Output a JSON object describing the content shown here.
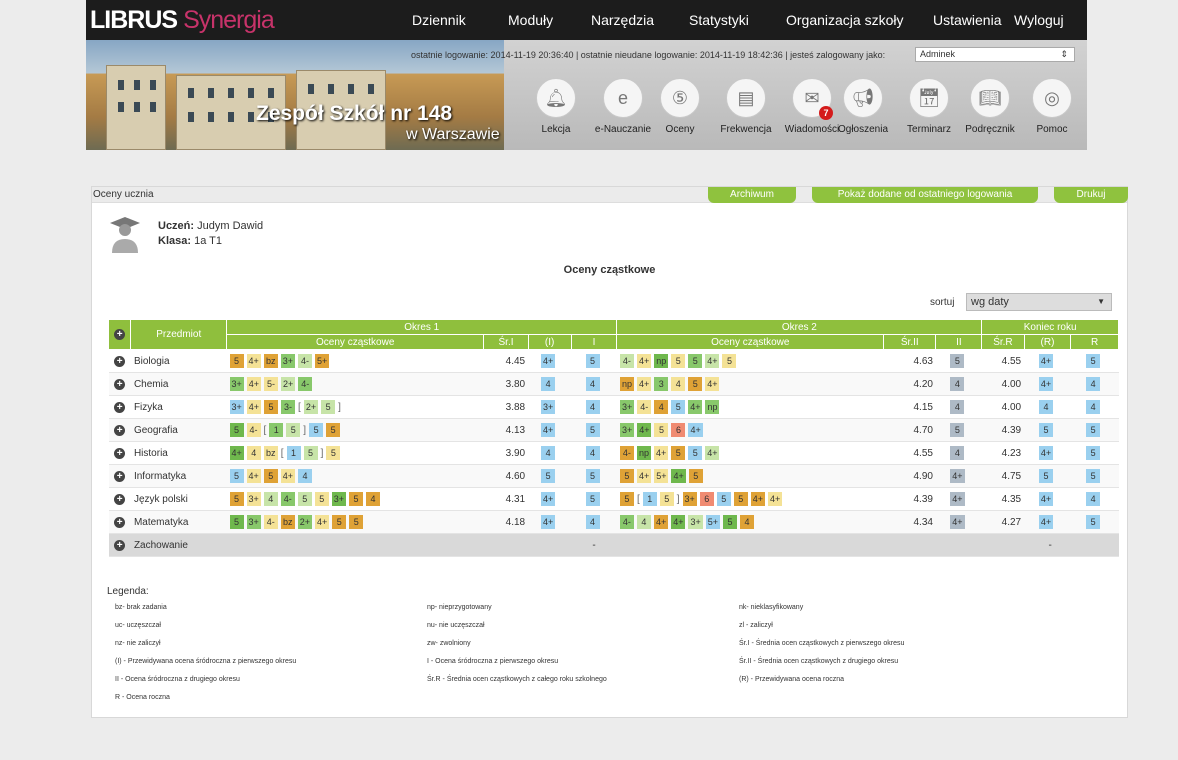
{
  "header": {
    "logo_main": "LIBRUS",
    "logo_sub": "Synergia",
    "nav": [
      "Dziennik",
      "Moduły",
      "Narzędzia",
      "Statystyki",
      "Organizacja szkoły",
      "Ustawienia",
      "Wyloguj"
    ],
    "login_info": "ostatnie logowanie: 2014-11-19 20:36:40  |  ostatnie nieudane logowanie: 2014-11-19 18:42:36  |  jesteś zalogowany jako:",
    "user": "Adminek",
    "school_name": "Zespół Szkół nr 148",
    "school_city": "w Warszawie",
    "modules": [
      {
        "label": "Lekcja",
        "icon": "bell-icon"
      },
      {
        "label": "e-Nauczanie",
        "icon": "e-icon"
      },
      {
        "label": "Oceny",
        "icon": "grade-icon"
      },
      {
        "label": "Frekwencja",
        "icon": "attendance-icon"
      },
      {
        "label": "Wiadomości",
        "icon": "envelope-icon",
        "badge": "7"
      },
      {
        "label": "Ogłoszenia",
        "icon": "megaphone-icon"
      },
      {
        "label": "Terminarz",
        "icon": "calendar-icon"
      },
      {
        "label": "Podręcznik",
        "icon": "book-icon"
      },
      {
        "label": "Pomoc",
        "icon": "lifebuoy-icon"
      }
    ]
  },
  "panel": {
    "title": "Oceny ucznia",
    "buttons": [
      "Archiwum",
      "Pokaż dodane od ostatniego logowania",
      "Drukuj"
    ],
    "student_label": "Uczeń:",
    "student_name": "Judym Dawid",
    "class_label": "Klasa:",
    "class_name": "1a T1",
    "section_title": "Oceny cząstkowe",
    "sort_label": "sortuj",
    "sort_value": "wg daty"
  },
  "table": {
    "headers": {
      "subject": "Przedmiot",
      "period1": "Okres 1",
      "period2": "Okres 2",
      "year_end": "Koniec roku",
      "partial": "Oceny cząstkowe",
      "avg1": "Śr.I",
      "pred1": "(I)",
      "final1": "I",
      "avg2": "Śr.II",
      "final2": "II",
      "avgR": "Śr.R",
      "predR": "(R)",
      "finalR": "R"
    },
    "rows": [
      {
        "subject": "Biologia",
        "p1": [
          [
            "5",
            "o"
          ],
          [
            "4+",
            "y"
          ],
          [
            "bz",
            "o"
          ],
          [
            "3+",
            "g"
          ],
          [
            "4-",
            "lg"
          ],
          [
            "5+",
            "o"
          ]
        ],
        "avg1": "4.45",
        "pred1": "4+",
        "final1": "5",
        "p2": [
          [
            "4-",
            "lg"
          ],
          [
            "4+",
            "y"
          ],
          [
            "np",
            "dg"
          ],
          [
            "5",
            "y"
          ],
          [
            "5",
            "g"
          ],
          [
            "4+",
            "lg"
          ],
          [
            "5",
            "y"
          ]
        ],
        "avg2": "4.63",
        "final2": "5",
        "avgR": "4.55",
        "predR": "4+",
        "finalR": "5"
      },
      {
        "subject": "Chemia",
        "p1": [
          [
            "3+",
            "g"
          ],
          [
            "4+",
            "y"
          ],
          [
            "5-",
            "y"
          ],
          [
            "2+",
            "lg"
          ],
          [
            "4-",
            "g"
          ]
        ],
        "avg1": "3.80",
        "pred1": "4",
        "final1": "4",
        "p2": [
          [
            "np",
            "o"
          ],
          [
            "4+",
            "y"
          ],
          [
            "3",
            "g"
          ],
          [
            "4",
            "y"
          ],
          [
            "5",
            "o"
          ],
          [
            "4+",
            "y"
          ]
        ],
        "avg2": "4.20",
        "final2": "4",
        "avgR": "4.00",
        "predR": "4+",
        "finalR": "4"
      },
      {
        "subject": "Fizyka",
        "p1": [
          [
            "3+",
            "b"
          ],
          [
            "4+",
            "y"
          ],
          [
            "5",
            "o"
          ],
          [
            "3-",
            "g"
          ],
          [
            "[",
            "x"
          ],
          [
            "2+",
            "lg"
          ],
          [
            "5",
            "lg"
          ],
          [
            "]",
            "x"
          ]
        ],
        "avg1": "3.88",
        "pred1": "3+",
        "final1": "4",
        "p2": [
          [
            "3+",
            "g"
          ],
          [
            "4-",
            "y"
          ],
          [
            "4",
            "o"
          ],
          [
            "5",
            "b"
          ],
          [
            "4+",
            "g"
          ],
          [
            "np",
            "g"
          ]
        ],
        "avg2": "4.15",
        "final2": "4",
        "avgR": "4.00",
        "predR": "4",
        "finalR": "4"
      },
      {
        "subject": "Geografia",
        "p1": [
          [
            "5",
            "dg"
          ],
          [
            "4-",
            "y"
          ],
          [
            "[",
            "x"
          ],
          [
            "1",
            "g"
          ],
          [
            "5",
            "lg"
          ],
          [
            "]",
            "x"
          ],
          [
            "5",
            "b"
          ],
          [
            "5",
            "o"
          ]
        ],
        "avg1": "4.13",
        "pred1": "4+",
        "final1": "5",
        "p2": [
          [
            "3+",
            "g"
          ],
          [
            "4+",
            "dg"
          ],
          [
            "5",
            "y"
          ],
          [
            "6",
            "r"
          ],
          [
            "4+",
            "b"
          ]
        ],
        "avg2": "4.70",
        "final2": "5",
        "avgR": "4.39",
        "predR": "5",
        "finalR": "5"
      },
      {
        "subject": "Historia",
        "p1": [
          [
            "4+",
            "dg"
          ],
          [
            "4",
            "y"
          ],
          [
            "bz",
            "y"
          ],
          [
            "[",
            "x"
          ],
          [
            "1",
            "b"
          ],
          [
            "5",
            "lg"
          ],
          [
            "]",
            "x"
          ],
          [
            "5",
            "y"
          ]
        ],
        "avg1": "3.90",
        "pred1": "4",
        "final1": "4",
        "p2": [
          [
            "4-",
            "o"
          ],
          [
            "np",
            "dg"
          ],
          [
            "4+",
            "y"
          ],
          [
            "5",
            "o"
          ],
          [
            "5",
            "b"
          ],
          [
            "4+",
            "lg"
          ]
        ],
        "avg2": "4.55",
        "final2": "4",
        "avgR": "4.23",
        "predR": "4+",
        "finalR": "5"
      },
      {
        "subject": "Informatyka",
        "p1": [
          [
            "5",
            "b"
          ],
          [
            "4+",
            "y"
          ],
          [
            "5",
            "o"
          ],
          [
            "4+",
            "y"
          ],
          [
            "4",
            "b"
          ]
        ],
        "avg1": "4.60",
        "pred1": "5",
        "final1": "5",
        "p2": [
          [
            "5",
            "o"
          ],
          [
            "4+",
            "y"
          ],
          [
            "5+",
            "y"
          ],
          [
            "4+",
            "dg"
          ],
          [
            "5",
            "o"
          ]
        ],
        "avg2": "4.90",
        "final2": "4+",
        "avgR": "4.75",
        "predR": "5",
        "finalR": "5"
      },
      {
        "subject": "Język polski",
        "p1": [
          [
            "5",
            "o"
          ],
          [
            "3+",
            "y"
          ],
          [
            "4",
            "lg"
          ],
          [
            "4-",
            "g"
          ],
          [
            "5",
            "lg"
          ],
          [
            "5",
            "y"
          ],
          [
            "3+",
            "dg"
          ],
          [
            "5",
            "o"
          ],
          [
            "4",
            "o"
          ]
        ],
        "avg1": "4.31",
        "pred1": "4+",
        "final1": "5",
        "p2": [
          [
            "5",
            "o"
          ],
          [
            "[",
            "x"
          ],
          [
            "1",
            "b"
          ],
          [
            "5",
            "y"
          ],
          [
            "]",
            "x"
          ],
          [
            "3+",
            "o"
          ],
          [
            "6",
            "r"
          ],
          [
            "5",
            "b"
          ],
          [
            "5",
            "o"
          ],
          [
            "4+",
            "o"
          ],
          [
            "4+",
            "y"
          ]
        ],
        "avg2": "4.39",
        "final2": "4+",
        "avgR": "4.35",
        "predR": "4+",
        "finalR": "4"
      },
      {
        "subject": "Matematyka",
        "p1": [
          [
            "5",
            "dg"
          ],
          [
            "3+",
            "g"
          ],
          [
            "4-",
            "y"
          ],
          [
            "bz",
            "o"
          ],
          [
            "2+",
            "g"
          ],
          [
            "4+",
            "y"
          ],
          [
            "5",
            "o"
          ],
          [
            "5",
            "o"
          ]
        ],
        "avg1": "4.18",
        "pred1": "4+",
        "final1": "4",
        "p2": [
          [
            "4-",
            "g"
          ],
          [
            "4",
            "lg"
          ],
          [
            "4+",
            "o"
          ],
          [
            "4+",
            "dg"
          ],
          [
            "3+",
            "lg"
          ],
          [
            "5+",
            "b"
          ],
          [
            "5",
            "dg"
          ],
          [
            "4",
            "o"
          ]
        ],
        "avg2": "4.34",
        "final2": "4+",
        "avgR": "4.27",
        "predR": "4+",
        "finalR": "5"
      }
    ],
    "conduct": {
      "subject": "Zachowanie",
      "final1": "-",
      "finalR": "-"
    }
  },
  "legend": {
    "title": "Legenda:",
    "col1": [
      "bz- brak zadania",
      "uc- uczęszczał",
      "nz- nie zaliczył",
      "(I) - Przewidywana ocena śródroczna z pierwszego okresu",
      "II - Ocena śródroczna z drugiego okresu",
      "R - Ocena roczna"
    ],
    "col2": [
      "np- nieprzygotowany",
      "nu- nie uczęszczał",
      "zw- zwolniony",
      "I - Ocena śródroczna z pierwszego okresu",
      "Śr.R - Średnia ocen cząstkowych z całego roku szkolnego"
    ],
    "col3": [
      "nk- nieklasyfikowany",
      "zl - zaliczył",
      "Śr.I - Średnia ocen cząstkowych z pierwszego okresu",
      "Śr.II - Średnia ocen cząstkowych z drugiego okresu",
      "(R) - Przewidywana ocena roczna"
    ]
  },
  "colors": {
    "green": "#8fbf3d",
    "yellow": "#f4e296",
    "orange": "#dfa236",
    "grade_green": "#88c86b",
    "light_green": "#c7e4a8",
    "blue": "#9ad0ef",
    "grey": "#aebac6",
    "red": "#f08b72",
    "badge": "#d41b1b"
  }
}
